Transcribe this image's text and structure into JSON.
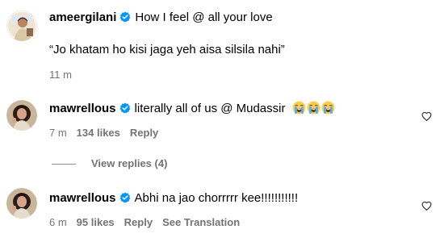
{
  "comments": [
    {
      "username": "ameergilani",
      "text": "How I feel @ all your love",
      "quote": "“Jo khatam ho kisi jaga yeh aisa silsila nahi”",
      "time": "11 m"
    },
    {
      "username": "mawrellous",
      "text": "literally all of us @ Mudassir",
      "emojis": [
        "loudly-crying-face",
        "loudly-crying-face",
        "loudly-crying-face"
      ],
      "time": "7 m",
      "likes": "134 likes",
      "reply_label": "Reply",
      "view_replies": "View replies (4)"
    },
    {
      "username": "mawrellous",
      "text": "Abhi na jao chorrrrr kee!!!!!!!!!!!",
      "time": "6 m",
      "likes": "95 likes",
      "reply_label": "Reply",
      "translation_label": "See Translation"
    }
  ],
  "icons": {
    "verified": "verified-badge-icon",
    "like": "heart-icon"
  },
  "colors": {
    "verified_blue": "#0095f6",
    "meta_gray": "#737373",
    "text": "#000000"
  }
}
